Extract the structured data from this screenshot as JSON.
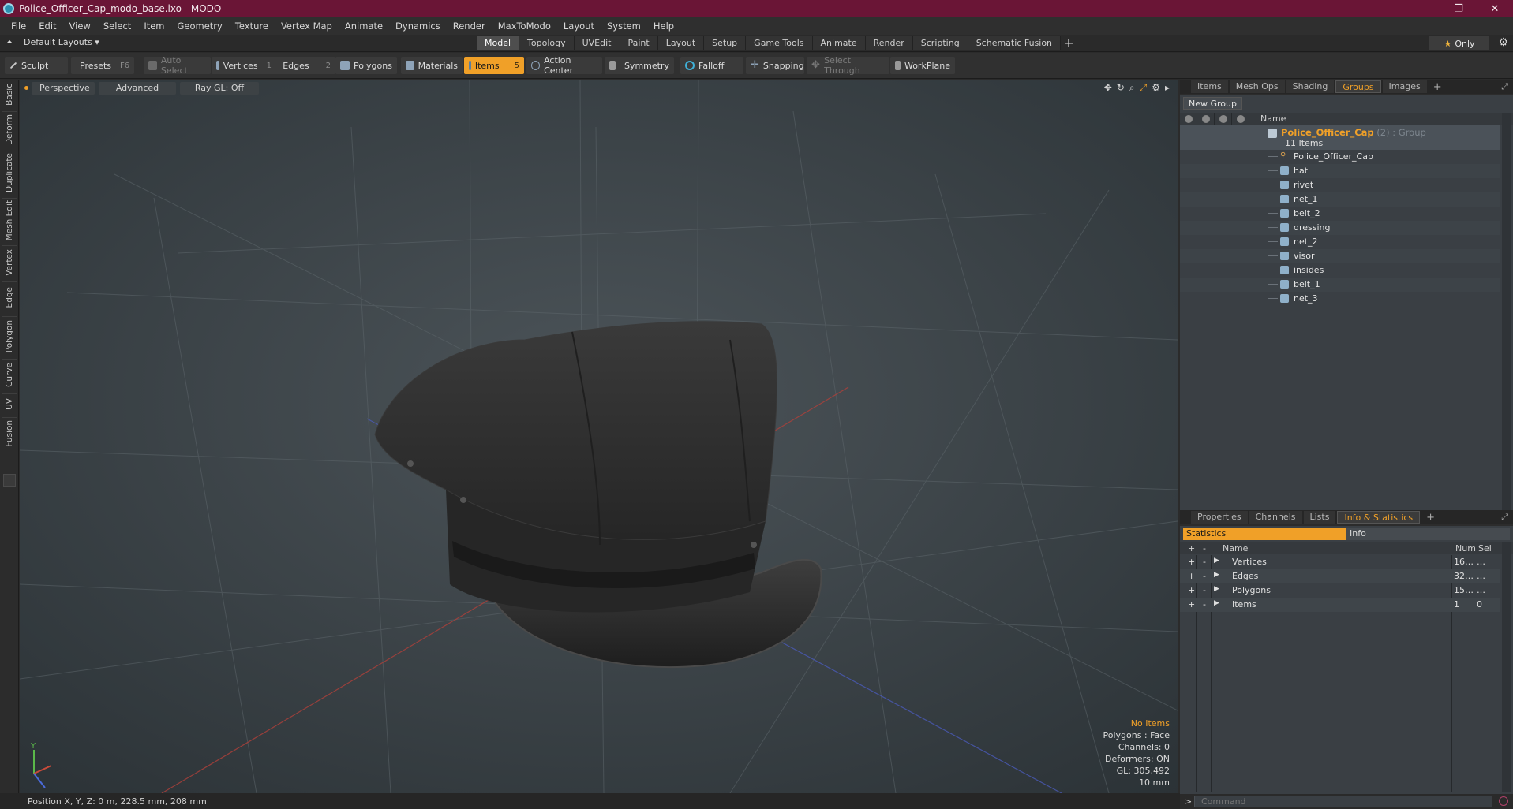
{
  "window": {
    "title": "Police_Officer_Cap_modo_base.lxo - MODO",
    "controls": {
      "minimize": "—",
      "restore": "❐",
      "close": "✕"
    }
  },
  "menu": [
    "File",
    "Edit",
    "View",
    "Select",
    "Item",
    "Geometry",
    "Texture",
    "Vertex Map",
    "Animate",
    "Dynamics",
    "Render",
    "MaxToModo",
    "Layout",
    "System",
    "Help"
  ],
  "layout_bar": {
    "layouts_label": "Default Layouts ▾",
    "tabs": [
      "Model",
      "Topology",
      "UVEdit",
      "Paint",
      "Layout",
      "Setup",
      "Game Tools",
      "Animate",
      "Render",
      "Scripting",
      "Schematic Fusion"
    ],
    "active_tab": "Model",
    "add": "+",
    "only_label": "Only",
    "only_star": "★",
    "settings_glyph": "⚙"
  },
  "toolbar": {
    "sculpt": "Sculpt",
    "presets": "Presets",
    "presets_key": "F6",
    "auto_select": "Auto Select",
    "vertices": "Vertices",
    "vertices_key": "1",
    "edges": "Edges",
    "edges_key": "2",
    "polygons": "Polygons",
    "materials": "Materials",
    "items": "Items",
    "items_key": "5",
    "action_center": "Action Center",
    "symmetry": "Symmetry",
    "falloff": "Falloff",
    "snapping": "Snapping",
    "select_through": "Select Through",
    "workplane": "WorkPlane"
  },
  "left_tabs": [
    "Basic",
    "Deform",
    "Duplicate",
    "Mesh Edit",
    "Vertex",
    "Edge",
    "Polygon",
    "Curve",
    "UV",
    "Fusion"
  ],
  "viewport": {
    "view_mode": "Perspective",
    "shading": "Advanced",
    "raygl": "Ray GL: Off",
    "info": {
      "selection": "No Items",
      "polygons": "Polygons : Face",
      "channels": "Channels: 0",
      "deformers": "Deformers: ON",
      "gl": "GL: 305,492",
      "scale": "10 mm"
    },
    "axis_label": "Y"
  },
  "status": {
    "position": "Position X, Y, Z:   0 m, 228.5 mm, 208 mm"
  },
  "top_panel": {
    "tabs": [
      "Items",
      "Mesh Ops",
      "Shading",
      "Groups",
      "Images"
    ],
    "active_tab": "Groups",
    "add": "+",
    "new_group": "New Group",
    "column_name": "Name",
    "group": {
      "name": "Police_Officer_Cap",
      "extra": " (2) : Group",
      "count": "11 Items"
    },
    "items": [
      "Police_Officer_Cap",
      "hat",
      "rivet",
      "net_1",
      "belt_2",
      "dressing",
      "net_2",
      "visor",
      "insides",
      "belt_1",
      "net_3"
    ]
  },
  "bottom_panel": {
    "tabs": [
      "Properties",
      "Channels",
      "Lists",
      "Info & Statistics"
    ],
    "active_tab": "Info & Statistics",
    "add": "+",
    "sub_tabs": {
      "statistics": "Statistics",
      "info": "Info"
    },
    "columns": {
      "plus": "+",
      "minus": "-",
      "name": "Name",
      "num": "Num",
      "sel": "Sel"
    },
    "rows": [
      {
        "name": "Vertices",
        "num": "16…",
        "sel": "…"
      },
      {
        "name": "Edges",
        "num": "32…",
        "sel": "…"
      },
      {
        "name": "Polygons",
        "num": "15…",
        "sel": "…"
      },
      {
        "name": "Items",
        "num": "1",
        "sel": "0"
      }
    ]
  },
  "command": {
    "prompt": ">",
    "placeholder": "Command"
  }
}
